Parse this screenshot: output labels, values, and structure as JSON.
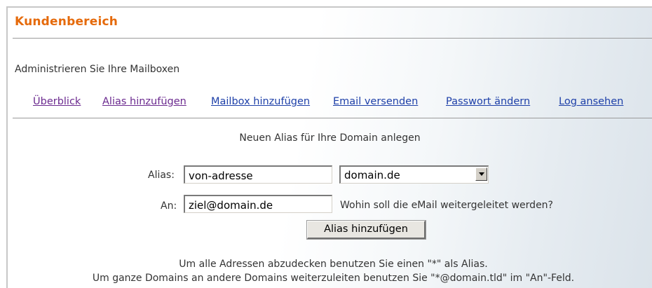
{
  "header": {
    "title": "Kundenbereich",
    "subtitle": "Administrieren Sie Ihre Mailboxen"
  },
  "nav": {
    "items": [
      {
        "label": "Überblick",
        "state": "visited"
      },
      {
        "label": "Alias hinzufügen",
        "state": "visited"
      },
      {
        "label": "Mailbox hinzufügen",
        "state": "link"
      },
      {
        "label": "Email versenden",
        "state": "link"
      },
      {
        "label": "Passwort ändern",
        "state": "link"
      },
      {
        "label": "Log ansehen",
        "state": "link"
      }
    ]
  },
  "form": {
    "heading": "Neuen Alias für Ihre Domain anlegen",
    "alias_label": "Alias:",
    "alias_value": "von-adresse",
    "domain_selected": "domain.de",
    "an_label": "An:",
    "an_value": "ziel@domain.de",
    "an_hint": "Wohin soll die eMail weitergeleitet werden?",
    "submit_label": "Alias hinzufügen"
  },
  "notes": {
    "line1": "Um alle Adressen abzudecken benutzen Sie einen \"*\" als Alias.",
    "line2": "Um ganze Domains an andere Domains weiterzuleiten benutzen Sie \"*@domain.tld\" im \"An\"-Feld."
  },
  "colors": {
    "title": "#e56a0b",
    "link": "#1d3fa8",
    "visited_link": "#6b2a8f"
  }
}
